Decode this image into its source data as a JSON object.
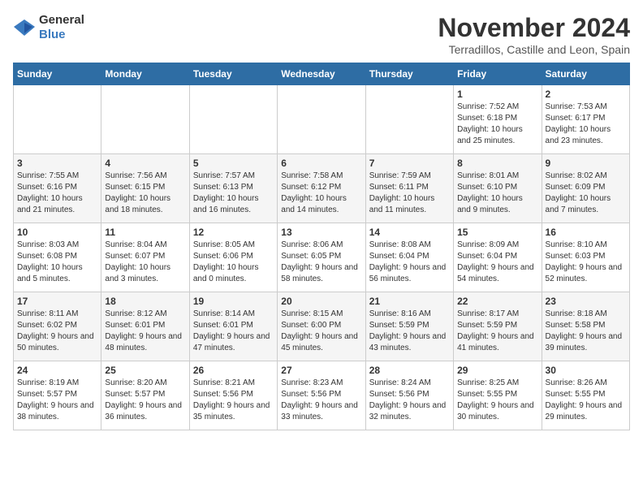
{
  "header": {
    "logo_general": "General",
    "logo_blue": "Blue",
    "month": "November 2024",
    "location": "Terradillos, Castille and Leon, Spain"
  },
  "days_of_week": [
    "Sunday",
    "Monday",
    "Tuesday",
    "Wednesday",
    "Thursday",
    "Friday",
    "Saturday"
  ],
  "weeks": [
    [
      {
        "day": "",
        "info": ""
      },
      {
        "day": "",
        "info": ""
      },
      {
        "day": "",
        "info": ""
      },
      {
        "day": "",
        "info": ""
      },
      {
        "day": "",
        "info": ""
      },
      {
        "day": "1",
        "info": "Sunrise: 7:52 AM\nSunset: 6:18 PM\nDaylight: 10 hours and 25 minutes."
      },
      {
        "day": "2",
        "info": "Sunrise: 7:53 AM\nSunset: 6:17 PM\nDaylight: 10 hours and 23 minutes."
      }
    ],
    [
      {
        "day": "3",
        "info": "Sunrise: 7:55 AM\nSunset: 6:16 PM\nDaylight: 10 hours and 21 minutes."
      },
      {
        "day": "4",
        "info": "Sunrise: 7:56 AM\nSunset: 6:15 PM\nDaylight: 10 hours and 18 minutes."
      },
      {
        "day": "5",
        "info": "Sunrise: 7:57 AM\nSunset: 6:13 PM\nDaylight: 10 hours and 16 minutes."
      },
      {
        "day": "6",
        "info": "Sunrise: 7:58 AM\nSunset: 6:12 PM\nDaylight: 10 hours and 14 minutes."
      },
      {
        "day": "7",
        "info": "Sunrise: 7:59 AM\nSunset: 6:11 PM\nDaylight: 10 hours and 11 minutes."
      },
      {
        "day": "8",
        "info": "Sunrise: 8:01 AM\nSunset: 6:10 PM\nDaylight: 10 hours and 9 minutes."
      },
      {
        "day": "9",
        "info": "Sunrise: 8:02 AM\nSunset: 6:09 PM\nDaylight: 10 hours and 7 minutes."
      }
    ],
    [
      {
        "day": "10",
        "info": "Sunrise: 8:03 AM\nSunset: 6:08 PM\nDaylight: 10 hours and 5 minutes."
      },
      {
        "day": "11",
        "info": "Sunrise: 8:04 AM\nSunset: 6:07 PM\nDaylight: 10 hours and 3 minutes."
      },
      {
        "day": "12",
        "info": "Sunrise: 8:05 AM\nSunset: 6:06 PM\nDaylight: 10 hours and 0 minutes."
      },
      {
        "day": "13",
        "info": "Sunrise: 8:06 AM\nSunset: 6:05 PM\nDaylight: 9 hours and 58 minutes."
      },
      {
        "day": "14",
        "info": "Sunrise: 8:08 AM\nSunset: 6:04 PM\nDaylight: 9 hours and 56 minutes."
      },
      {
        "day": "15",
        "info": "Sunrise: 8:09 AM\nSunset: 6:04 PM\nDaylight: 9 hours and 54 minutes."
      },
      {
        "day": "16",
        "info": "Sunrise: 8:10 AM\nSunset: 6:03 PM\nDaylight: 9 hours and 52 minutes."
      }
    ],
    [
      {
        "day": "17",
        "info": "Sunrise: 8:11 AM\nSunset: 6:02 PM\nDaylight: 9 hours and 50 minutes."
      },
      {
        "day": "18",
        "info": "Sunrise: 8:12 AM\nSunset: 6:01 PM\nDaylight: 9 hours and 48 minutes."
      },
      {
        "day": "19",
        "info": "Sunrise: 8:14 AM\nSunset: 6:01 PM\nDaylight: 9 hours and 47 minutes."
      },
      {
        "day": "20",
        "info": "Sunrise: 8:15 AM\nSunset: 6:00 PM\nDaylight: 9 hours and 45 minutes."
      },
      {
        "day": "21",
        "info": "Sunrise: 8:16 AM\nSunset: 5:59 PM\nDaylight: 9 hours and 43 minutes."
      },
      {
        "day": "22",
        "info": "Sunrise: 8:17 AM\nSunset: 5:59 PM\nDaylight: 9 hours and 41 minutes."
      },
      {
        "day": "23",
        "info": "Sunrise: 8:18 AM\nSunset: 5:58 PM\nDaylight: 9 hours and 39 minutes."
      }
    ],
    [
      {
        "day": "24",
        "info": "Sunrise: 8:19 AM\nSunset: 5:57 PM\nDaylight: 9 hours and 38 minutes."
      },
      {
        "day": "25",
        "info": "Sunrise: 8:20 AM\nSunset: 5:57 PM\nDaylight: 9 hours and 36 minutes."
      },
      {
        "day": "26",
        "info": "Sunrise: 8:21 AM\nSunset: 5:56 PM\nDaylight: 9 hours and 35 minutes."
      },
      {
        "day": "27",
        "info": "Sunrise: 8:23 AM\nSunset: 5:56 PM\nDaylight: 9 hours and 33 minutes."
      },
      {
        "day": "28",
        "info": "Sunrise: 8:24 AM\nSunset: 5:56 PM\nDaylight: 9 hours and 32 minutes."
      },
      {
        "day": "29",
        "info": "Sunrise: 8:25 AM\nSunset: 5:55 PM\nDaylight: 9 hours and 30 minutes."
      },
      {
        "day": "30",
        "info": "Sunrise: 8:26 AM\nSunset: 5:55 PM\nDaylight: 9 hours and 29 minutes."
      }
    ]
  ]
}
